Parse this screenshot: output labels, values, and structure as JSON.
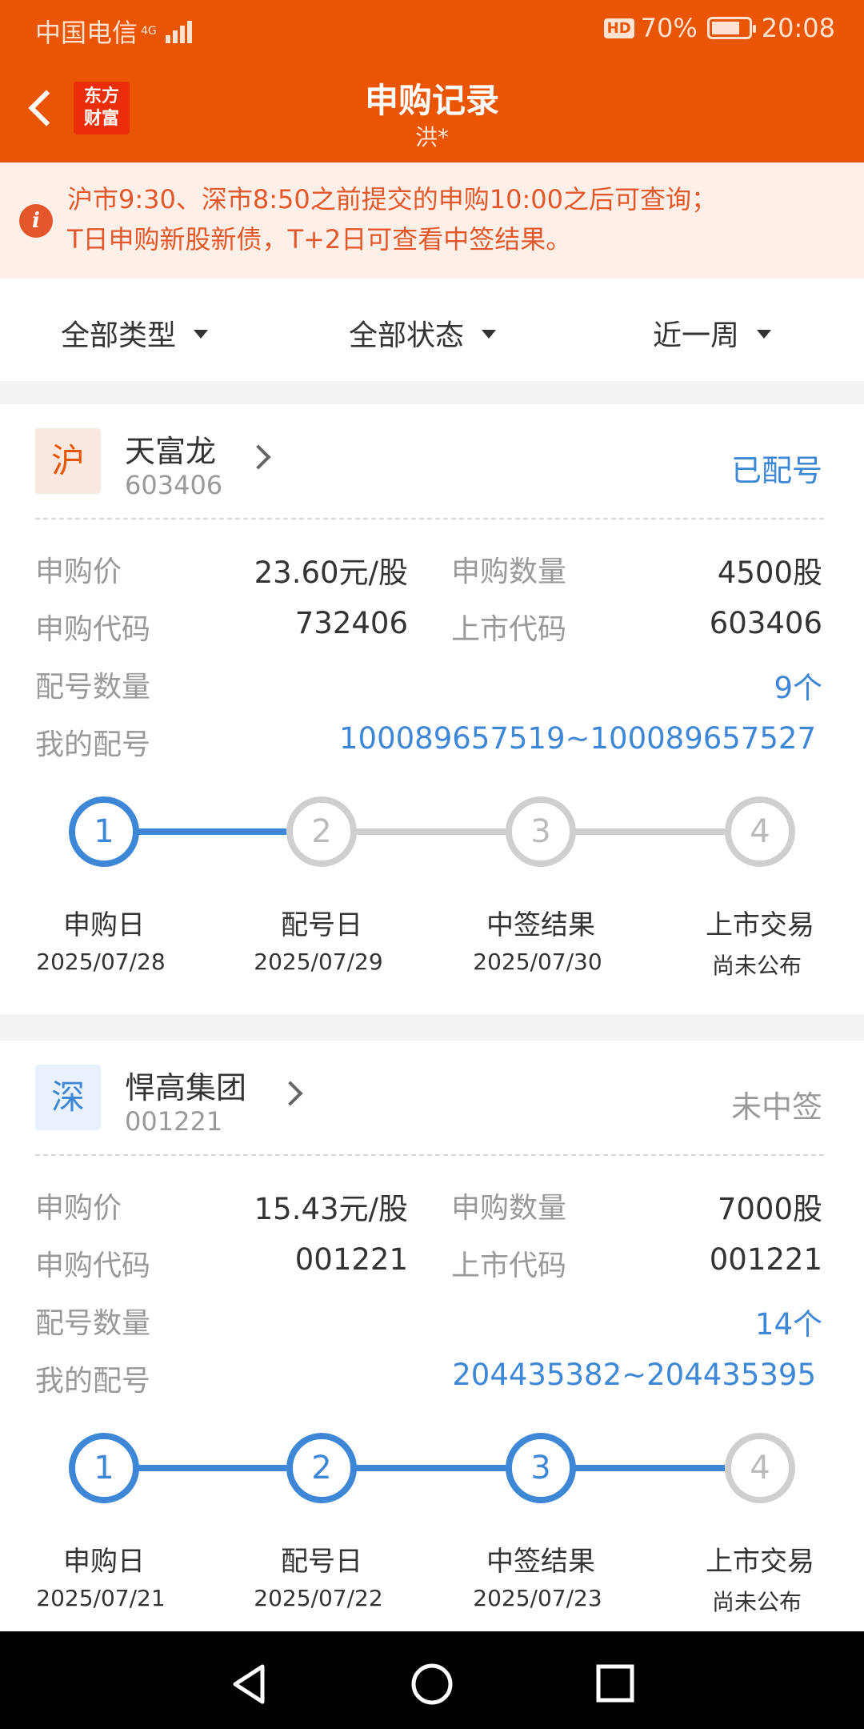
{
  "status_bar": {
    "carrier": "中国电信",
    "network": "4G",
    "hd": "HD",
    "battery": "70%",
    "time": "20:08"
  },
  "header": {
    "logo_line1": "东方",
    "logo_line2": "财富",
    "title": "申购记录",
    "subtitle": "洪*"
  },
  "notice": {
    "icon": "i",
    "line1": "沪市9:30、深市8:50之前提交的申购10:00之后可查询；",
    "line2": "T日申购新股新债，T+2日可查看中签结果。"
  },
  "filters": {
    "type": "全部类型",
    "status": "全部状态",
    "period": "近一周"
  },
  "labels": {
    "price": "申购价",
    "quantity": "申购数量",
    "sub_code": "申购代码",
    "list_code": "上市代码",
    "match_count": "配号数量",
    "my_match": "我的配号"
  },
  "records": [
    {
      "market": "沪",
      "name": "天富龙",
      "code": "603406",
      "status": "已配号",
      "price": "23.60元/股",
      "quantity": "4500股",
      "sub_code": "732406",
      "list_code": "603406",
      "match_count": "9个",
      "my_match": "100089657519~100089657527",
      "steps": [
        {
          "num": "1",
          "name": "申购日",
          "date": "2025/07/28",
          "done": true
        },
        {
          "num": "2",
          "name": "配号日",
          "date": "2025/07/29",
          "done": false
        },
        {
          "num": "3",
          "name": "中签结果",
          "date": "2025/07/30",
          "done": false
        },
        {
          "num": "4",
          "name": "上市交易",
          "date": "尚未公布",
          "done": false
        }
      ]
    },
    {
      "market": "深",
      "name": "悍高集团",
      "code": "001221",
      "status": "未中签",
      "price": "15.43元/股",
      "quantity": "7000股",
      "sub_code": "001221",
      "list_code": "001221",
      "match_count": "14个",
      "my_match": "204435382~204435395",
      "steps": [
        {
          "num": "1",
          "name": "申购日",
          "date": "2025/07/21",
          "done": true
        },
        {
          "num": "2",
          "name": "配号日",
          "date": "2025/07/22",
          "done": true
        },
        {
          "num": "3",
          "name": "中签结果",
          "date": "2025/07/23",
          "done": true
        },
        {
          "num": "4",
          "name": "上市交易",
          "date": "尚未公布",
          "done": false
        }
      ]
    }
  ],
  "colors": {
    "brand": "#ea5504",
    "accent_blue": "#3d87d6",
    "notice_text": "#e4572a"
  }
}
